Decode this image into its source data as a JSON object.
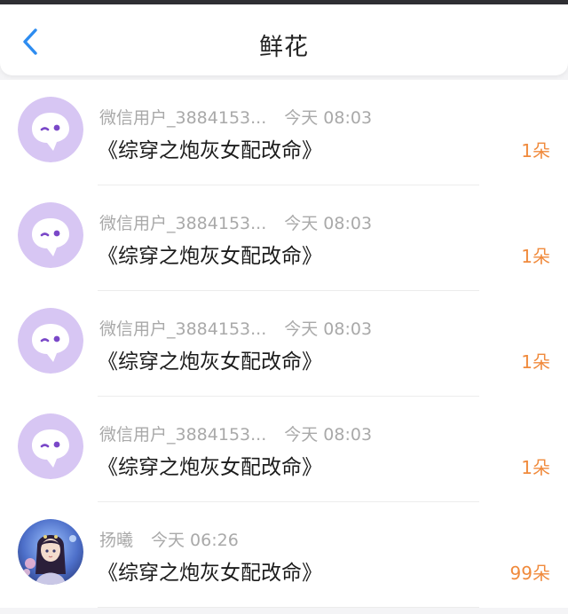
{
  "header": {
    "title": "鲜花",
    "back_icon": "chevron-left-icon",
    "accent": "#2d8cf0"
  },
  "records": [
    {
      "avatar": "chat-bubble-avatar",
      "user": "微信用户_3884153...",
      "time": "今天 08:03",
      "book": "《综穿之炮灰女配改命》",
      "count": "1朵"
    },
    {
      "avatar": "chat-bubble-avatar",
      "user": "微信用户_3884153...",
      "time": "今天 08:03",
      "book": "《综穿之炮灰女配改命》",
      "count": "1朵"
    },
    {
      "avatar": "chat-bubble-avatar",
      "user": "微信用户_3884153...",
      "time": "今天 08:03",
      "book": "《综穿之炮灰女配改命》",
      "count": "1朵"
    },
    {
      "avatar": "chat-bubble-avatar",
      "user": "微信用户_3884153...",
      "time": "今天 08:03",
      "book": "《综穿之炮灰女配改命》",
      "count": "1朵"
    },
    {
      "avatar": "portrait-photo-avatar",
      "user": "扬曦",
      "time": "今天 06:26",
      "book": "《综穿之炮灰女配改命》",
      "count": "99朵"
    }
  ],
  "colors": {
    "count": "#f08a3c",
    "default_avatar_bg": "#d7c6f3",
    "default_avatar_icon": "#7a48c8"
  }
}
